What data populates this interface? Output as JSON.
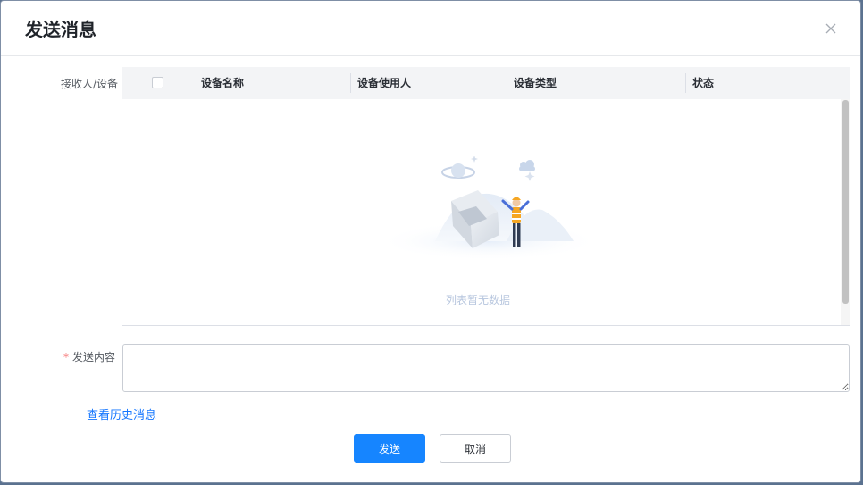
{
  "dialog": {
    "title": "发送消息",
    "close_icon": "close-icon"
  },
  "form": {
    "recipient_label": "接收人/设备",
    "content_label": "发送内容",
    "content_required_mark": "*",
    "content_value": ""
  },
  "table": {
    "columns": [
      "设备名称",
      "设备使用人",
      "设备类型",
      "状态"
    ],
    "rows": [],
    "empty_text": "列表暂无数据",
    "empty_icon": "empty-box-illustration"
  },
  "links": {
    "history": "查看历史消息"
  },
  "buttons": {
    "send": "发送",
    "cancel": "取消"
  },
  "colors": {
    "primary": "#1685ff",
    "link": "#1677ff",
    "required": "#f56c6c",
    "empty_text": "#b7c6de"
  }
}
